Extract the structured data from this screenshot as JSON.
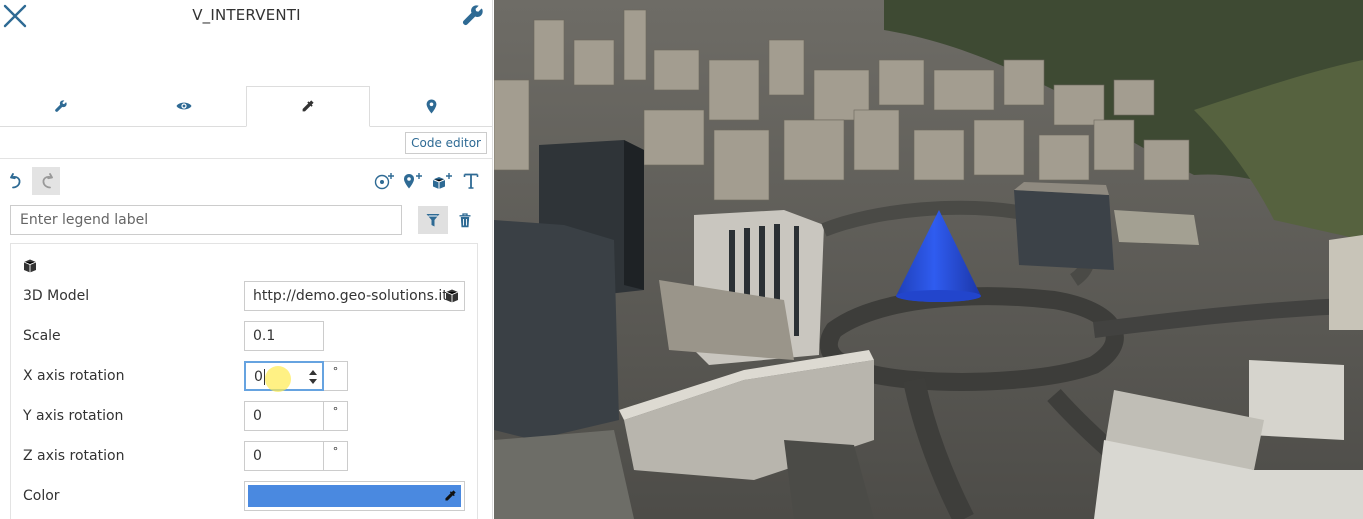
{
  "header": {
    "title": "V_INTERVENTI"
  },
  "tabs": [
    {
      "icon": "wrench-icon"
    },
    {
      "icon": "eye-icon"
    },
    {
      "icon": "eyedropper-icon",
      "active": true
    },
    {
      "icon": "map-pin-icon"
    }
  ],
  "code_editor_label": "Code editor",
  "toolbar": {
    "undo_icon": "undo-icon",
    "redo_icon": "redo-icon",
    "tools": [
      "add-circle-icon",
      "add-marker-icon",
      "add-model-icon",
      "add-text-icon"
    ]
  },
  "legend": {
    "placeholder": "Enter legend label"
  },
  "fields": {
    "model": {
      "label": "3D Model",
      "value": "http://demo.geo-solutions.it"
    },
    "scale": {
      "label": "Scale",
      "value": "0.1"
    },
    "x_rotation": {
      "label": "X axis rotation",
      "value": "0",
      "unit": "°"
    },
    "y_rotation": {
      "label": "Y axis rotation",
      "value": "0",
      "unit": "°"
    },
    "z_rotation": {
      "label": "Z axis rotation",
      "value": "0",
      "unit": "°"
    },
    "color": {
      "label": "Color",
      "value": "#4a89e0"
    }
  },
  "colors": {
    "accent": "#2e6a94",
    "cone": "#2a54e6"
  }
}
